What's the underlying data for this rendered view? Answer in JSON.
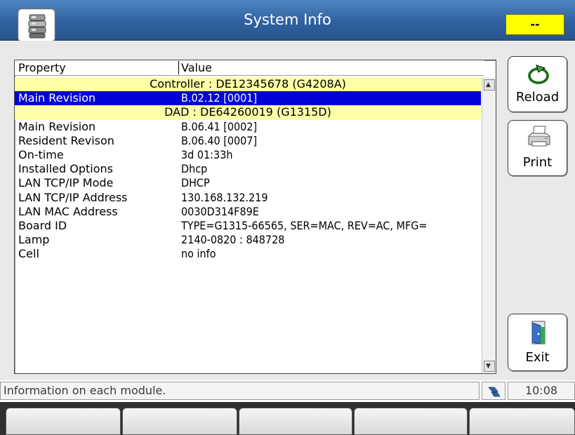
{
  "window": {
    "title": "System Info",
    "status_indicator": "--",
    "app_icon": "instrument-stack-icon"
  },
  "table": {
    "headers": {
      "property": "Property",
      "value": "Value"
    },
    "rows": [
      {
        "group": "Controller : DE12345678 (G4208A)"
      },
      {
        "property": "Main Revision",
        "value": "B.02.12 [0001]",
        "selected": true
      },
      {
        "group": "DAD : DE64260019 (G1315D)"
      },
      {
        "property": "Main Revision",
        "value": "B.06.41 [0002]"
      },
      {
        "property": "Resident Revison",
        "value": "B.06.40 [0007]"
      },
      {
        "property": "On-time",
        "value": "3d 01:33h"
      },
      {
        "property": "Installed Options",
        "value": "Dhcp"
      },
      {
        "property": "LAN TCP/IP Mode",
        "value": "DHCP"
      },
      {
        "property": "LAN TCP/IP Address",
        "value": "130.168.132.219"
      },
      {
        "property": "LAN MAC Address",
        "value": "0030D314F89E"
      },
      {
        "property": "Board ID",
        "value": "TYPE=G1315-66565, SER=MAC, REV=AC, MFG="
      },
      {
        "property": "Lamp",
        "value": "2140-0820 : 848728"
      },
      {
        "property": "Cell",
        "value": "no info"
      }
    ]
  },
  "buttons": {
    "reload": "Reload",
    "print": "Print",
    "exit": "Exit"
  },
  "status": {
    "message": "Information on each module.",
    "clock": "10:08",
    "network_icon": "network-icon"
  },
  "colors": {
    "title_bar": "#2f61a0",
    "indicator": "#ffff00",
    "group_row": "#ffffa8",
    "selected_row": "#0000d8"
  }
}
